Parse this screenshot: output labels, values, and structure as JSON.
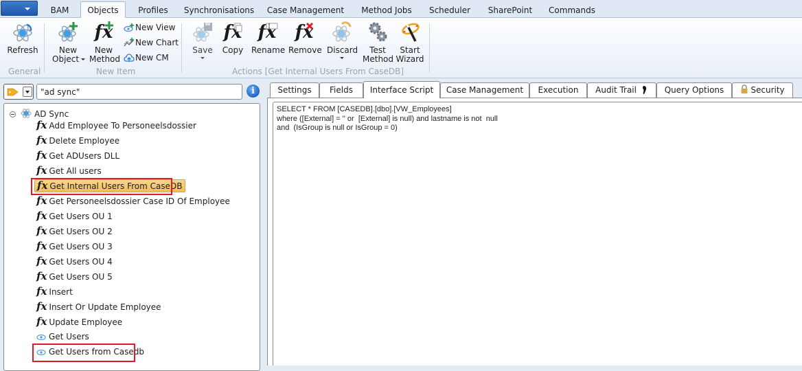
{
  "ribbon_tabs": [
    {
      "label": "BAM"
    },
    {
      "label": "Objects",
      "active": true
    },
    {
      "label": "Profiles"
    },
    {
      "label": "Synchronisations"
    },
    {
      "label": "Case Management"
    },
    {
      "label": "Method Jobs"
    },
    {
      "label": "Scheduler"
    },
    {
      "label": "SharePoint"
    },
    {
      "label": "Commands"
    }
  ],
  "ribbon": {
    "groups": {
      "general": "General",
      "new_item": "New Item",
      "actions": "Actions [Get Internal Users From CaseDB]"
    },
    "refresh": "Refresh",
    "new_object": [
      "New",
      "Object"
    ],
    "new_method": [
      "New",
      "Method"
    ],
    "new_view": "New View",
    "new_chart": "New Chart",
    "new_cm": "New CM",
    "save": "Save",
    "copy": "Copy",
    "rename": "Rename",
    "remove": "Remove",
    "discard": "Discard",
    "test_method": [
      "Test",
      "Method"
    ],
    "start_wizard": [
      "Start",
      "Wizard"
    ]
  },
  "search": {
    "value": "\"ad sync\"",
    "info_glyph": "i"
  },
  "tree": {
    "root": "AD Sync",
    "fx_glyph": "fx",
    "items": [
      {
        "label": "Add Employee To Personeelsdossier",
        "type": "method"
      },
      {
        "label": "Delete Employee",
        "type": "method"
      },
      {
        "label": "Get ADUsers DLL",
        "type": "method"
      },
      {
        "label": "Get All users",
        "type": "method"
      },
      {
        "label": "Get Internal Users From CaseDB",
        "type": "method",
        "selected": true
      },
      {
        "label": "Get Personeelsdossier Case ID Of Employee",
        "type": "method"
      },
      {
        "label": "Get Users OU 1",
        "type": "method"
      },
      {
        "label": "Get Users OU 2",
        "type": "method"
      },
      {
        "label": "Get Users OU 3",
        "type": "method"
      },
      {
        "label": "Get Users OU 4",
        "type": "method"
      },
      {
        "label": "Get Users OU 5",
        "type": "method"
      },
      {
        "label": "Insert",
        "type": "method"
      },
      {
        "label": "Insert Or Update Employee",
        "type": "method"
      },
      {
        "label": "Update Employee",
        "type": "method"
      },
      {
        "label": "Get Users",
        "type": "view"
      },
      {
        "label": "Get Users from Casedb",
        "type": "view"
      }
    ]
  },
  "detail_tabs": [
    {
      "label": "Settings"
    },
    {
      "label": "Fields"
    },
    {
      "label": "Interface Script",
      "active": true
    },
    {
      "label": "Case Management"
    },
    {
      "label": "Execution"
    },
    {
      "label": "Audit Trail"
    },
    {
      "label": "Query Options"
    },
    {
      "label": "Security"
    }
  ],
  "script": "SELECT * FROM [CASEDB].[dbo].[VW_Employees]\nwhere ([External] = '' or  [External] is null) and lastname is not  null\nand  (IsGroup is null or IsGroup = 0)",
  "colors": {
    "selection_fill": "#f2be5c",
    "highlight_box": "#e01b24",
    "app_button": "#1f58ad"
  }
}
